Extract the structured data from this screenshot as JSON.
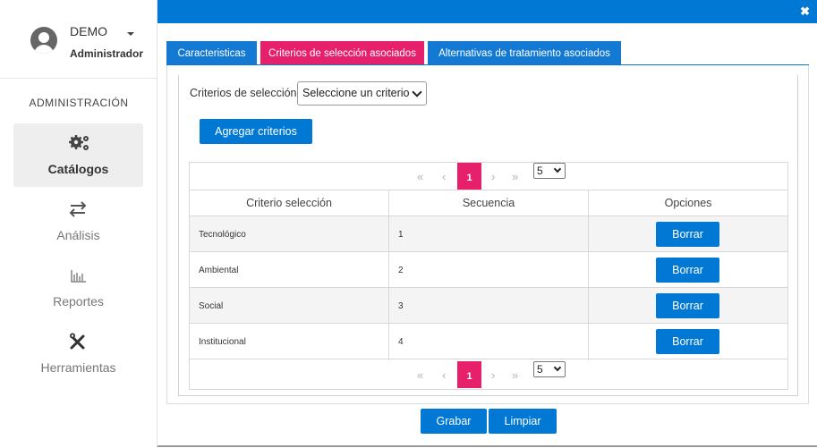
{
  "sidebar": {
    "user_name": "DEMO",
    "user_role": "Administrador",
    "section_title": "ADMINISTRACIÓN",
    "items": [
      {
        "label": "Catálogos",
        "icon": "gears-icon",
        "active": true
      },
      {
        "label": "Análisis",
        "icon": "arrows-exchange-icon",
        "active": false
      },
      {
        "label": "Reportes",
        "icon": "bar-chart-icon",
        "active": false
      },
      {
        "label": "Herramientas",
        "icon": "tools-icon",
        "active": false
      }
    ]
  },
  "modal": {
    "close": "✖",
    "tabs": [
      {
        "label": "Caracteristicas",
        "active": false
      },
      {
        "label": "Criterios de selección asociados",
        "active": true
      },
      {
        "label": "Alternativas de tratamiento asociados",
        "active": false
      }
    ],
    "criteria_label": "Criterios de selección:",
    "select_value": "Seleccione un criterio",
    "add_button": "Agregar criterios",
    "pager": {
      "first": "«",
      "prev": "‹",
      "current": "1",
      "next": "›",
      "last": "»",
      "page_size": "5"
    },
    "table": {
      "headers": [
        "Criterio selección",
        "Secuencia",
        "Opciones"
      ],
      "rows": [
        {
          "criterio": "Tecnológico",
          "secuencia": "1",
          "accion": "Borrar"
        },
        {
          "criterio": "Ambiental",
          "secuencia": "2",
          "accion": "Borrar"
        },
        {
          "criterio": "Social",
          "secuencia": "3",
          "accion": "Borrar"
        },
        {
          "criterio": "Institucional",
          "secuencia": "4",
          "accion": "Borrar"
        }
      ]
    },
    "footer": {
      "save": "Grabar",
      "clear": "Limpiar"
    }
  },
  "colors": {
    "primary": "#0078d4",
    "accent": "#e6206a"
  }
}
